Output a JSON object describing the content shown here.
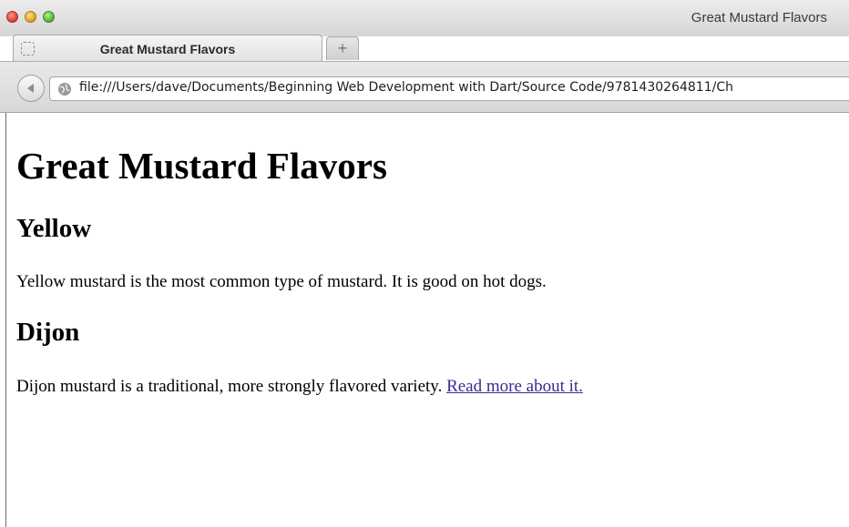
{
  "window": {
    "title": "Great Mustard Flavors"
  },
  "tabs": [
    {
      "label": "Great Mustard Flavors",
      "icon": "blank-page-icon"
    }
  ],
  "new_tab_label": "+",
  "address_bar": {
    "url": "file:///Users/dave/Documents/Beginning Web Development with Dart/Source Code/9781430264811/Ch"
  },
  "page": {
    "heading": "Great Mustard Flavors",
    "sections": [
      {
        "heading": "Yellow",
        "text": "Yellow mustard is the most common type of mustard. It is good on hot dogs."
      },
      {
        "heading": "Dijon",
        "text": "Dijon mustard is a traditional, more strongly flavored variety. ",
        "link": "Read more about it."
      }
    ]
  },
  "colors": {
    "link": "#3f2891",
    "close_button": "#e0443a",
    "minimize_button": "#e0a526",
    "maximize_button": "#58b734"
  }
}
